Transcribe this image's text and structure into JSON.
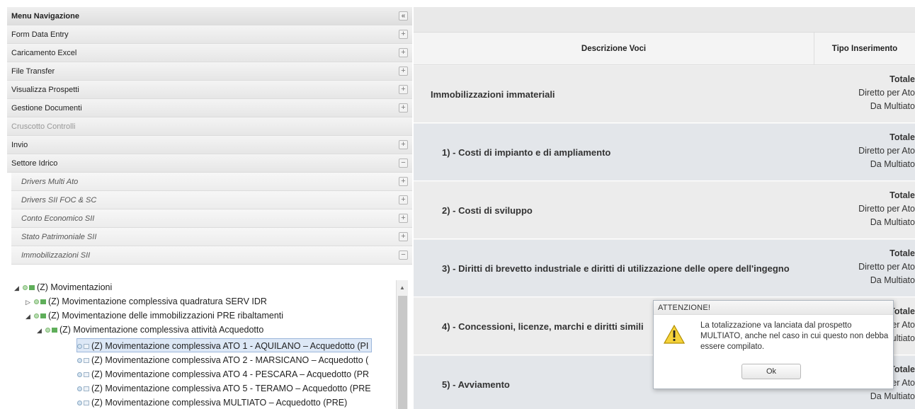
{
  "sidebar": {
    "title": "Menu Navigazione",
    "collapse_glyph": "«",
    "items": [
      {
        "label": "Form Data Entry",
        "toggle": "+"
      },
      {
        "label": "Caricamento Excel",
        "toggle": "+"
      },
      {
        "label": "File Transfer",
        "toggle": "+"
      },
      {
        "label": "Visualizza Prospetti",
        "toggle": "+"
      },
      {
        "label": "Gestione Documenti",
        "toggle": "+"
      },
      {
        "label": "Cruscotto Controlli",
        "toggle": ""
      },
      {
        "label": "Invio",
        "toggle": "+"
      },
      {
        "label": "Settore Idrico",
        "toggle": "−"
      }
    ],
    "subitems": [
      {
        "label": "Drivers Multi Ato",
        "toggle": "+"
      },
      {
        "label": "Drivers SII FOC & SC",
        "toggle": "+"
      },
      {
        "label": "Conto Economico SII",
        "toggle": "+"
      },
      {
        "label": "Stato Patrimoniale SII",
        "toggle": "+"
      },
      {
        "label": "Immobilizzazioni SII",
        "toggle": "−"
      }
    ],
    "tree": [
      {
        "label": "(Z)  Movimentazioni",
        "arrow": "◢"
      },
      {
        "label": "(Z)  Movimentazione complessiva quadratura SERV IDR",
        "arrow": "▷"
      },
      {
        "label": "(Z)  Movimentazione delle immobilizzazioni PRE ribaltamenti",
        "arrow": "◢"
      },
      {
        "label": "(Z)  Movimentazione complessiva attività Acquedotto",
        "arrow": "◢"
      },
      {
        "label": "(Z)  Movimentazione complessiva ATO 1 - AQUILANO – Acquedotto (PI",
        "arrow": ""
      },
      {
        "label": "(Z)  Movimentazione complessiva ATO 2 - MARSICANO – Acquedotto (",
        "arrow": ""
      },
      {
        "label": "(Z)  Movimentazione complessiva ATO 4 - PESCARA – Acquedotto (PR",
        "arrow": ""
      },
      {
        "label": "(Z)  Movimentazione complessiva ATO 5 - TERAMO – Acquedotto (PRE",
        "arrow": ""
      },
      {
        "label": "(Z)  Movimentazione complessiva MULTIATO – Acquedotto (PRE)",
        "arrow": ""
      }
    ]
  },
  "grid": {
    "col_desc": "Descrizione Voci",
    "col_type": "Tipo Inserimento",
    "type_labels": [
      "Totale",
      "Diretto per Ato",
      "Da Multiato"
    ],
    "rows": [
      {
        "desc": "Immobilizzazioni immateriali"
      },
      {
        "desc": "1) - Costi di impianto e di ampliamento"
      },
      {
        "desc": "2) - Costi di sviluppo"
      },
      {
        "desc": "3) - Diritti di brevetto industriale e diritti di utilizzazione delle opere dell'ingegno"
      },
      {
        "desc": "4) - Concessioni, licenze, marchi e diritti simili"
      },
      {
        "desc": "5) - Avviamento"
      }
    ]
  },
  "dialog": {
    "title": "ATTENZIONE!",
    "message": "La totalizzazione va lanciata dal prospetto MULTIATO, anche nel caso in cui questo non debba essere compilato.",
    "ok_label": "Ok"
  }
}
